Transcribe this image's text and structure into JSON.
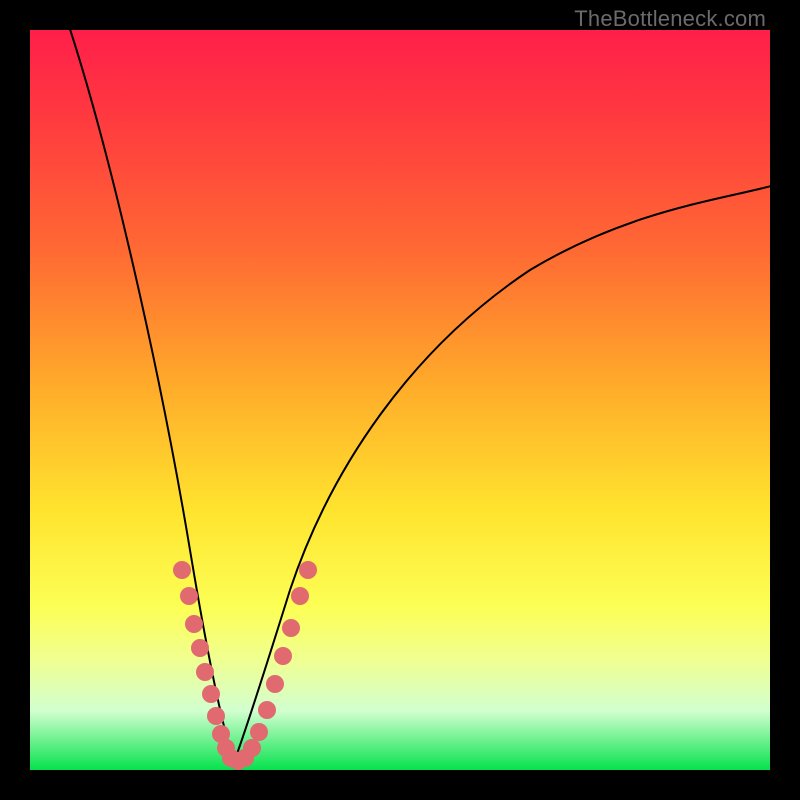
{
  "watermark": "TheBottleneck.com",
  "colors": {
    "frame": "#000000",
    "gradient_top": "#ff1f4a",
    "gradient_bottom": "#06e24e",
    "curve": "#000000",
    "dots": "#e06a6f"
  },
  "chart_data": {
    "type": "line",
    "title": "",
    "xlabel": "",
    "ylabel": "",
    "xlim": [
      0,
      100
    ],
    "ylim": [
      0,
      100
    ],
    "note": "x/y are percentage coordinates within the plot area (0=left/top edge, 100=right/bottom edge for x; 0=bottom, 100=top for y). Curve is a V-shaped bottleneck profile with minimum near x≈27.",
    "series": [
      {
        "name": "left-branch",
        "x": [
          5,
          10,
          15,
          20,
          22,
          24,
          26,
          27
        ],
        "y": [
          100,
          78,
          52,
          25,
          16,
          9,
          3,
          0
        ]
      },
      {
        "name": "right-branch",
        "x": [
          27,
          30,
          34,
          40,
          50,
          60,
          75,
          90,
          100
        ],
        "y": [
          0,
          6,
          16,
          31,
          48,
          58,
          68,
          75,
          79
        ]
      }
    ],
    "scatter": {
      "name": "sample-points",
      "note": "pink dots clustered along lower portion of both branches",
      "points": [
        {
          "x": 20.5,
          "y": 27
        },
        {
          "x": 21.5,
          "y": 23
        },
        {
          "x": 22.0,
          "y": 19
        },
        {
          "x": 22.8,
          "y": 16
        },
        {
          "x": 23.5,
          "y": 13
        },
        {
          "x": 24.3,
          "y": 10
        },
        {
          "x": 25.0,
          "y": 7
        },
        {
          "x": 25.7,
          "y": 5
        },
        {
          "x": 26.3,
          "y": 3
        },
        {
          "x": 27.0,
          "y": 1.5
        },
        {
          "x": 27.7,
          "y": 1
        },
        {
          "x": 28.5,
          "y": 1
        },
        {
          "x": 29.3,
          "y": 2
        },
        {
          "x": 30.0,
          "y": 4
        },
        {
          "x": 31.0,
          "y": 7
        },
        {
          "x": 32.0,
          "y": 11
        },
        {
          "x": 33.0,
          "y": 15
        },
        {
          "x": 34.0,
          "y": 19
        },
        {
          "x": 35.5,
          "y": 24
        },
        {
          "x": 36.5,
          "y": 27
        }
      ]
    }
  }
}
